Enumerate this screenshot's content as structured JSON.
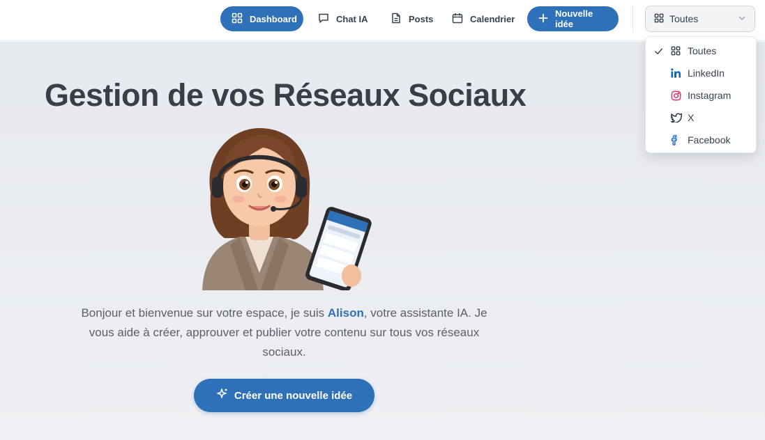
{
  "nav": {
    "dashboard": "Dashboard",
    "chat": "Chat IA",
    "posts": "Posts",
    "calendar": "Calendrier",
    "new_idea": "Nouvelle idée"
  },
  "filter": {
    "selected": "Toutes",
    "options": [
      "Toutes",
      "LinkedIn",
      "Instagram",
      "X",
      "Facebook"
    ]
  },
  "hero": {
    "title": "Gestion de vos Réseaux Sociaux",
    "intro_before": "Bonjour et bienvenue sur votre espace, je suis ",
    "assistant_name": "Alison",
    "intro_after": ", votre assistante IA. Je vous aide à créer, approuver et publier votre contenu sur tous vos réseaux sociaux.",
    "cta": "Créer une nouvelle idée"
  },
  "colors": {
    "accent": "#2f71b8",
    "linkedin": "#0a66c2",
    "instagram": "#e1306c",
    "facebook": "#1877f2"
  },
  "icons": {
    "dashboard": "grid-icon",
    "chat": "message-square-icon",
    "posts": "file-text-icon",
    "calendar": "calendar-icon",
    "new_idea": "plus-icon",
    "cta": "sparkles-icon"
  }
}
